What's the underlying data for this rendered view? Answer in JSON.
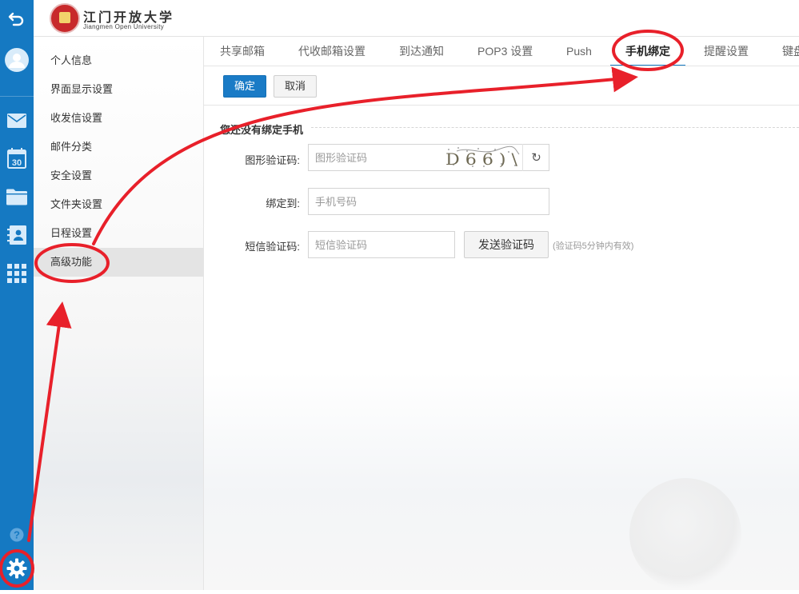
{
  "rail": {
    "icons": [
      "back-arrow-icon",
      "avatar-icon",
      "mail-icon",
      "calendar-icon",
      "folder-icon",
      "contacts-icon",
      "apps-grid-icon",
      "help-icon",
      "settings-gear-icon"
    ],
    "calendar_day": "30",
    "help_glyph": "?"
  },
  "header": {
    "logo_name_cn": "江门开放大学",
    "logo_name_en": "Jiangmen Open University"
  },
  "menu": {
    "items": [
      "个人信息",
      "界面显示设置",
      "收发信设置",
      "邮件分类",
      "安全设置",
      "文件夹设置",
      "日程设置",
      "高级功能"
    ],
    "active": "高级功能"
  },
  "tabs": {
    "items": [
      "共享邮箱",
      "代收邮箱设置",
      "到达通知",
      "POP3 设置",
      "Push",
      "手机绑定",
      "提醒设置",
      "键盘"
    ],
    "active": "手机绑定"
  },
  "toolbar": {
    "confirm_label": "确定",
    "cancel_label": "取消"
  },
  "form": {
    "section_title": "您还没有绑定手机",
    "captcha_label": "图形验证码:",
    "captcha_placeholder": "图形验证码",
    "captcha_text": "D 6 6 ) \\",
    "refresh_glyph": "↻",
    "phone_label": "绑定到:",
    "phone_placeholder": "手机号码",
    "sms_label": "短信验证码:",
    "sms_placeholder": "短信验证码",
    "send_code_label": "发送验证码",
    "hint": "(验证码5分钟内有效)"
  },
  "colors": {
    "rail": "#1579c2",
    "primary_button": "#1a7bc6",
    "annotation": "#e8202a"
  }
}
